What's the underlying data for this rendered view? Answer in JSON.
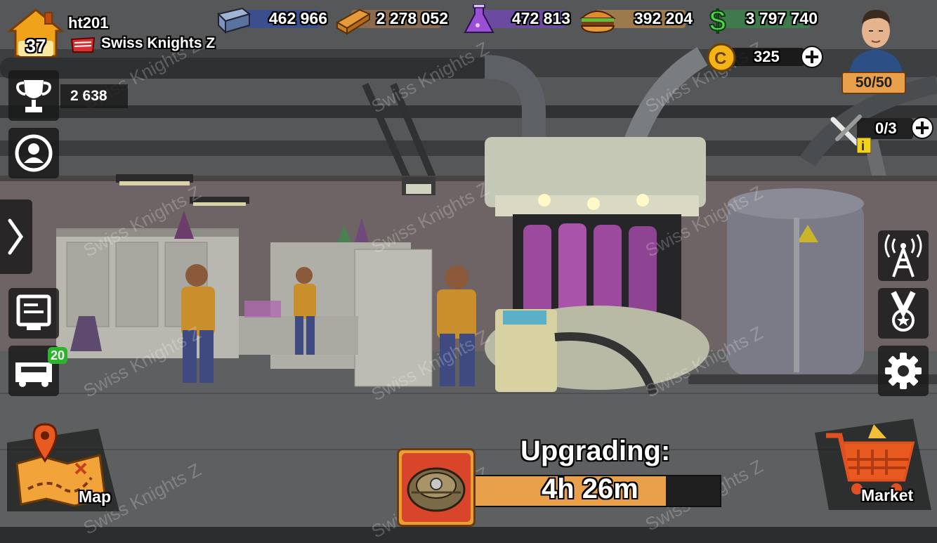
{
  "player": {
    "level": "37",
    "name": "ht201",
    "alliance": "Swiss Knights Z",
    "trophies": "2 638"
  },
  "resources": {
    "steel": "462 966",
    "wood": "2 278 052",
    "chemicals": "472 813",
    "food": "392 204",
    "cash": "3 797 740"
  },
  "coins": "325",
  "energy": "50/50",
  "builders": "0/3",
  "left_menu": {
    "notification_badge": "20"
  },
  "bottom": {
    "map_label": "Map",
    "market_label": "Market"
  },
  "upgrade": {
    "title": "Upgrading:",
    "timer": "4h 26m",
    "progress": 0.78
  },
  "watermark": "Swiss Knights Z",
  "icons": {
    "steel": "steel-beam-icon",
    "wood": "wood-planks-icon",
    "chemicals": "flask-icon",
    "food": "burger-icon",
    "cash": "dollar-icon",
    "coins": "coin-icon",
    "trophy": "trophy-icon",
    "profile": "profile-icon",
    "expand": "chevron-right-icon",
    "news": "screen-icon",
    "vehicle": "vehicle-icon",
    "radio": "radio-tower-icon",
    "medal": "medal-icon",
    "settings": "gear-icon",
    "builder": "tools-icon",
    "map": "map-icon",
    "market": "cart-icon"
  }
}
